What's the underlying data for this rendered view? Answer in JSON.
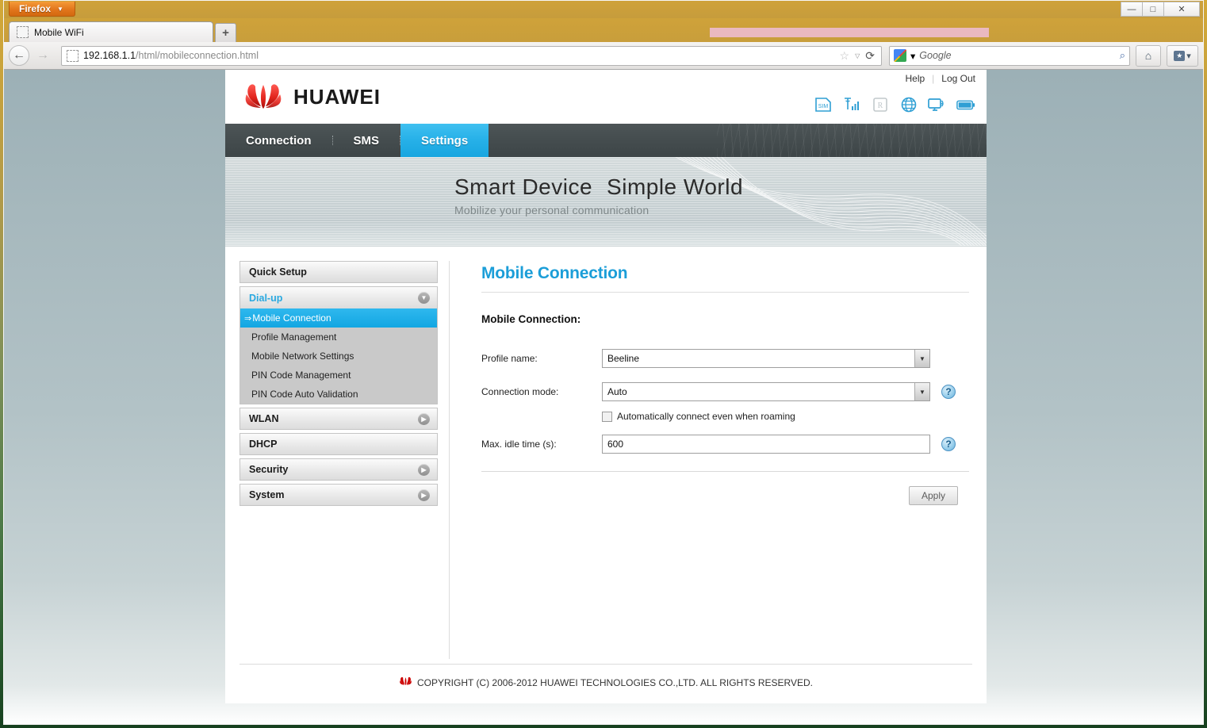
{
  "browser": {
    "app_button": "Firefox",
    "app_button_caret": "▼",
    "window_minimize": "—",
    "window_maximize": "□",
    "window_close": "✕",
    "tab_title": "Mobile WiFi",
    "new_tab": "+",
    "back_arrow": "←",
    "forward_arrow": "→",
    "url_host": "192.168.1.1",
    "url_path": "/html/mobileconnection.html",
    "star_icon": "☆",
    "dropmarker_icon": "▽",
    "reload_icon": "⟳",
    "search_engine": "Google",
    "search_engine_caret": "▾",
    "search_magnifier": "⌕",
    "home_icon": "⌂",
    "bookmarks_caret": "▾",
    "bookmarks_star": "★"
  },
  "header": {
    "brand": "HUAWEI",
    "links": {
      "help": "Help",
      "separator": "|",
      "logout": "Log Out"
    },
    "status_icons": [
      {
        "name": "sim-card-icon",
        "label": "SIM"
      },
      {
        "name": "signal-strength-icon",
        "label": "signal"
      },
      {
        "name": "roaming-icon",
        "label": "R"
      },
      {
        "name": "internet-globe-icon",
        "label": "globe"
      },
      {
        "name": "wifi-device-icon",
        "label": "wifi"
      },
      {
        "name": "battery-icon",
        "label": "battery"
      }
    ]
  },
  "nav": {
    "tabs": [
      {
        "label": "Connection",
        "active": false
      },
      {
        "label": "SMS",
        "active": false
      },
      {
        "label": "Settings",
        "active": true
      }
    ],
    "active_color": "#26b0e8"
  },
  "banner": {
    "headline_left": "Smart Device",
    "headline_right": "Simple World",
    "subline": "Mobilize your personal communication"
  },
  "sidebar": {
    "quick_setup": "Quick Setup",
    "dialup": "Dial-up",
    "dialup_items": [
      "Mobile Connection",
      "Profile Management",
      "Mobile Network Settings",
      "PIN Code Management",
      "PIN Code Auto Validation"
    ],
    "selected_item": "Mobile Connection",
    "selected_arrow": "⇒",
    "groups": [
      "WLAN",
      "DHCP",
      "Security",
      "System"
    ],
    "chevron_open": "▼",
    "chevron_closed": "▶",
    "selected_color": "#12a6e2"
  },
  "content": {
    "page_title": "Mobile Connection",
    "section_title": "Mobile Connection:",
    "title_color": "#1b9ed8",
    "fields": {
      "profile_name_label": "Profile name:",
      "profile_name_value": "Beeline",
      "connection_mode_label": "Connection mode:",
      "connection_mode_value": "Auto",
      "roaming_checkbox_label": "Automatically connect even when roaming",
      "roaming_checkbox_checked": false,
      "idle_time_label": "Max. idle time (s):",
      "idle_time_value": "600"
    },
    "help_icon": "?",
    "select_arrow": "▼",
    "apply_button": "Apply"
  },
  "footer": {
    "copyright": "COPYRIGHT (C) 2006-2012 HUAWEI TECHNOLOGIES CO.,LTD. ALL RIGHTS RESERVED.",
    "mark_word": "HUAWEI"
  }
}
